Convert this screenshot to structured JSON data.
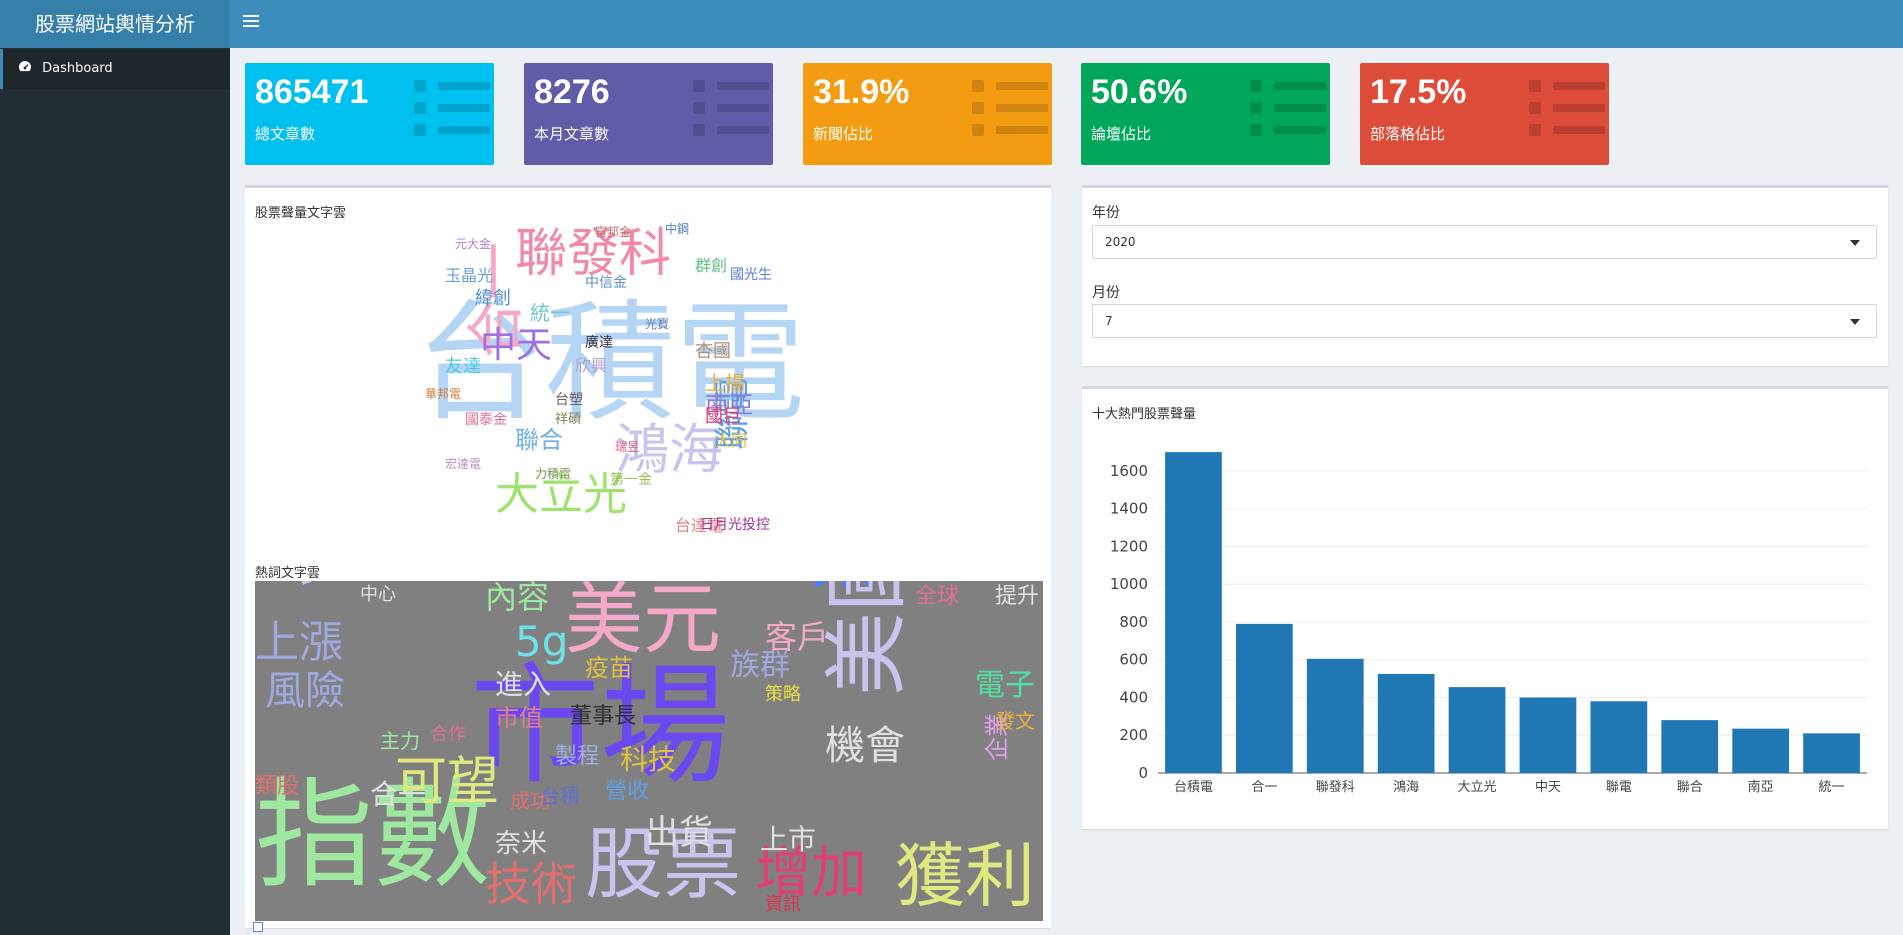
{
  "app": {
    "title": "股票網站輿情分析"
  },
  "sidebar": {
    "items": [
      {
        "label": "Dashboard",
        "icon": "dashboard-icon"
      }
    ]
  },
  "info_boxes": [
    {
      "value": "865471",
      "label": "總文章數",
      "color": "#00c0ef"
    },
    {
      "value": "8276",
      "label": "本月文章數",
      "color": "#605ca8"
    },
    {
      "value": "31.9%",
      "label": "新聞佔比",
      "color": "#f39c12"
    },
    {
      "value": "50.6%",
      "label": "論壇佔比",
      "color": "#00a65a"
    },
    {
      "value": "17.5%",
      "label": "部落格佔比",
      "color": "#dd4b39"
    }
  ],
  "stock_cloud": {
    "title": "股票聲量文字雲",
    "words": [
      "台積電",
      "聯發科",
      "合一",
      "鴻海",
      "大立光",
      "中天",
      "聯電",
      "南亞",
      "聯合",
      "統一",
      "緯創",
      "友達",
      "玉晶光",
      "國巨",
      "上揚",
      "杏國",
      "台達電",
      "日月光投控",
      "大同",
      "國光生",
      "中信金",
      "廣達",
      "台塑",
      "祥碩",
      "瑞昱",
      "富邦金",
      "第一金",
      "群創",
      "元大金",
      "國泰金",
      "欣興",
      "光寶",
      "華邦電",
      "宏達電",
      "中鋼",
      "力積電"
    ]
  },
  "keyword_cloud": {
    "title": "熱詞文字雲",
    "words": [
      "市場",
      "台股",
      "指數",
      "美元",
      "疫情",
      "美國",
      "股票",
      "獲利",
      "增加",
      "技術",
      "可望",
      "機會",
      "客戶",
      "上漲",
      "風險",
      "出貨",
      "上市",
      "族群",
      "電子",
      "內容",
      "5g",
      "中心",
      "提升",
      "企業",
      "進入",
      "疫苗",
      "市值",
      "董事長",
      "科技",
      "合一",
      "成功",
      "類股",
      "策略",
      "主力",
      "合作",
      "資訊",
      "發文",
      "奈米",
      "全球",
      "台積",
      "營收",
      "製程"
    ]
  },
  "filters": {
    "year": {
      "label": "年份",
      "value": "2020"
    },
    "month": {
      "label": "月份",
      "value": "7"
    }
  },
  "chart_panel": {
    "title": "十大熱門股票聲量"
  },
  "chart_data": {
    "type": "bar",
    "categories": [
      "台積電",
      "合一",
      "聯發科",
      "鴻海",
      "大立光",
      "中天",
      "聯電",
      "聯合",
      "南亞",
      "統一"
    ],
    "values": [
      1700,
      790,
      605,
      525,
      455,
      400,
      380,
      280,
      235,
      210
    ],
    "yticks": [
      0,
      200,
      400,
      600,
      800,
      1000,
      1200,
      1400,
      1600
    ],
    "ylim": [
      0,
      1780
    ],
    "color": "#1f77b4",
    "grid": true
  }
}
